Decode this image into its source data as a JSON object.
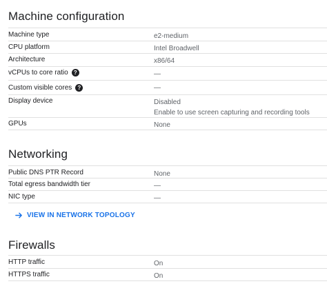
{
  "machine_configuration": {
    "title": "Machine configuration",
    "rows": [
      {
        "label": "Machine type",
        "value": "e2-medium"
      },
      {
        "label": "CPU platform",
        "value": "Intel Broadwell"
      },
      {
        "label": "Architecture",
        "value": "x86/64"
      },
      {
        "label": "vCPUs to core ratio",
        "value": "—"
      },
      {
        "label": "Custom visible cores",
        "value": "—"
      },
      {
        "label": "Display device",
        "value": "Disabled",
        "value2": "Enable to use screen capturing and recording tools"
      },
      {
        "label": "GPUs",
        "value": "None"
      }
    ]
  },
  "networking": {
    "title": "Networking",
    "rows": [
      {
        "label": "Public DNS PTR Record",
        "value": "None"
      },
      {
        "label": "Total egress bandwidth tier",
        "value": "—"
      },
      {
        "label": "NIC type",
        "value": "—"
      }
    ],
    "link_label": "VIEW IN NETWORK TOPOLOGY"
  },
  "firewalls": {
    "title": "Firewalls",
    "rows": [
      {
        "label": "HTTP traffic",
        "value": "On"
      },
      {
        "label": "HTTPS traffic",
        "value": "On"
      }
    ]
  },
  "colors": {
    "link": "#1a73e8",
    "divider": "#e0e0e0",
    "value_text": "#5f6368"
  },
  "icons": {
    "help": "help-circle-icon",
    "link_arrow": "arrow-right-icon"
  }
}
